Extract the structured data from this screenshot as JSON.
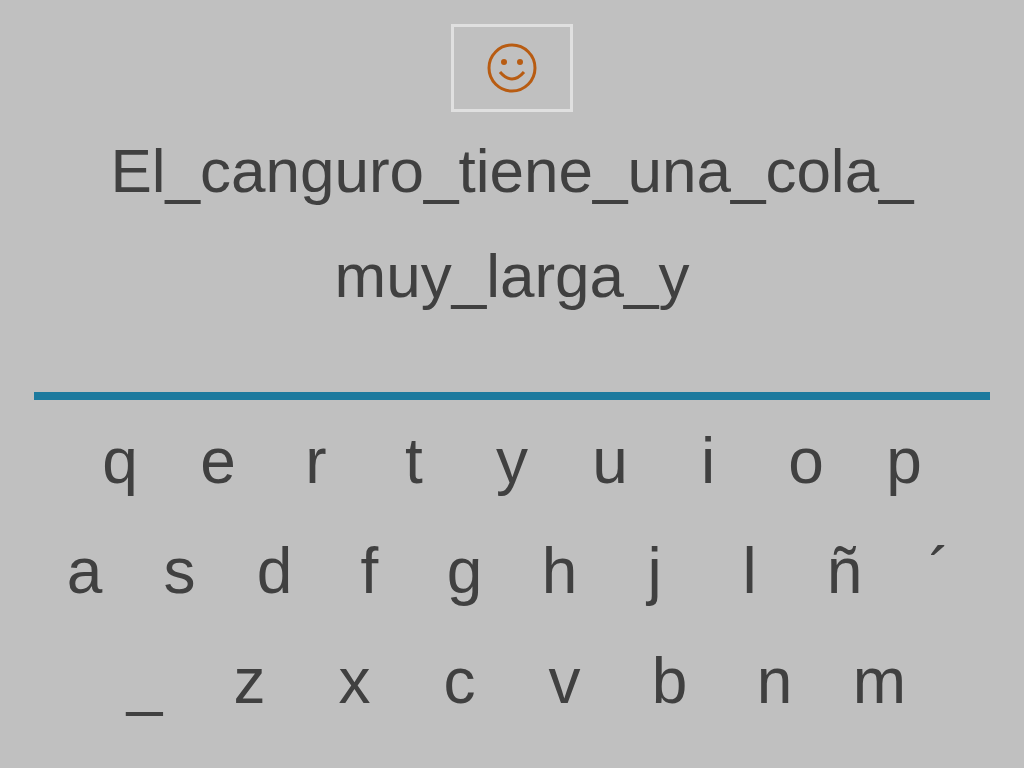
{
  "sentence_lines": [
    "El_canguro_tiene_una_cola_",
    "muy_larga_y"
  ],
  "keyboard": {
    "rows": [
      [
        "q",
        "e",
        "r",
        "t",
        "y",
        "u",
        "i",
        "o",
        "p"
      ],
      [
        "a",
        "s",
        "d",
        "f",
        "g",
        "h",
        "j",
        "l",
        "ñ",
        "´"
      ],
      [
        "_",
        "z",
        "x",
        "c",
        "v",
        "b",
        "n",
        "m"
      ]
    ]
  }
}
